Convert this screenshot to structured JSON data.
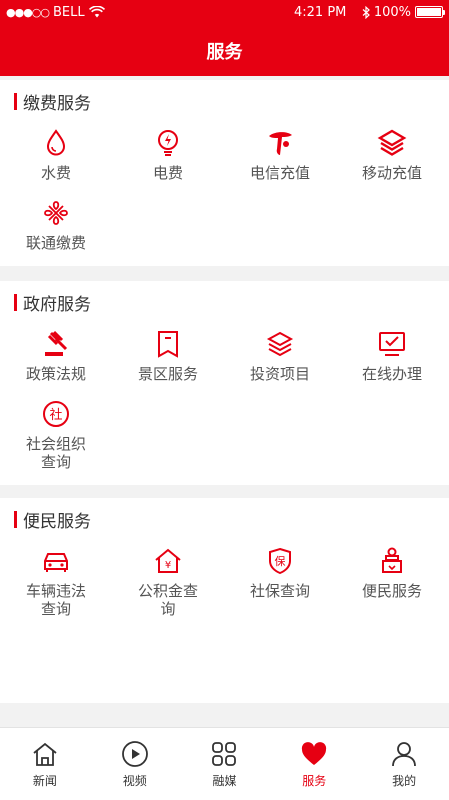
{
  "status": {
    "carrier": "BELL",
    "time": "4:21 PM",
    "battery": "100%",
    "signal_dots": "●●●○○"
  },
  "header": {
    "title": "服务"
  },
  "sections": {
    "payment": {
      "title": "缴费服务",
      "items": [
        {
          "label": "水费",
          "icon": "water-drop-icon"
        },
        {
          "label": "电费",
          "icon": "electricity-bulb-icon"
        },
        {
          "label": "电信充值",
          "icon": "china-telecom-icon"
        },
        {
          "label": "移动充值",
          "icon": "china-mobile-icon"
        },
        {
          "label": "联通缴费",
          "icon": "china-unicom-icon"
        }
      ]
    },
    "government": {
      "title": "政府服务",
      "items": [
        {
          "label": "政策法规",
          "icon": "gavel-icon"
        },
        {
          "label": "景区服务",
          "icon": "bookmark-icon"
        },
        {
          "label": "投资项目",
          "icon": "layers-icon"
        },
        {
          "label": "在线办理",
          "icon": "monitor-check-icon"
        },
        {
          "label1": "社会组织",
          "label2": "查询",
          "icon": "society-badge-icon"
        }
      ]
    },
    "convenience": {
      "title": "便民服务",
      "items": [
        {
          "label1": "车辆违法",
          "label2": "查询",
          "icon": "car-icon"
        },
        {
          "label1": "公积金查",
          "label2": "询",
          "icon": "house-yuan-icon"
        },
        {
          "label": "社保查询",
          "icon": "shield-bao-icon"
        },
        {
          "label": "便民服务",
          "icon": "service-person-icon"
        }
      ]
    }
  },
  "tabbar": {
    "items": [
      {
        "label": "新闻",
        "icon": "home-icon"
      },
      {
        "label": "视频",
        "icon": "play-circle-icon"
      },
      {
        "label": "融媒",
        "icon": "grid-icon"
      },
      {
        "label": "服务",
        "icon": "heart-icon",
        "active": true
      },
      {
        "label": "我的",
        "icon": "user-icon"
      }
    ]
  },
  "colors": {
    "accent": "#e60012",
    "text": "#333333",
    "muted": "#555555",
    "background": "#f2f2f2"
  }
}
